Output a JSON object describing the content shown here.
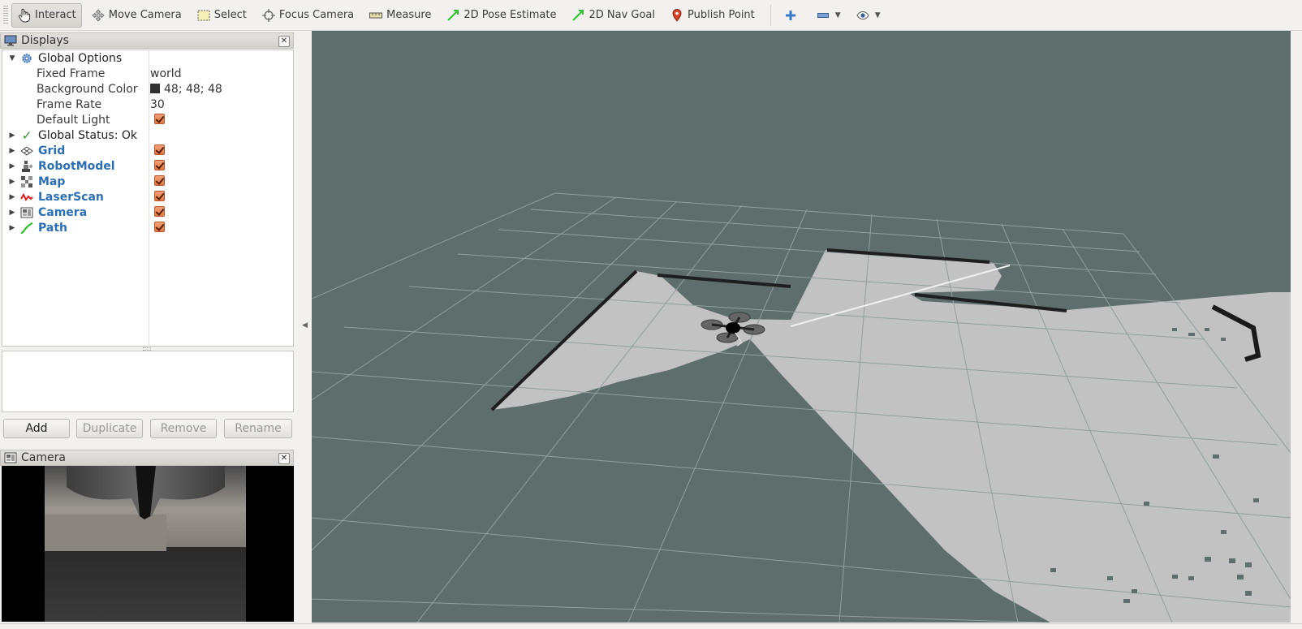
{
  "toolbar": {
    "tools": [
      {
        "label": "Interact",
        "icon": "hand-pointer-icon",
        "active": true
      },
      {
        "label": "Move Camera",
        "icon": "move-arrows-icon"
      },
      {
        "label": "Select",
        "icon": "selection-box-icon"
      },
      {
        "label": "Focus Camera",
        "icon": "crosshair-icon"
      },
      {
        "label": "Measure",
        "icon": "ruler-icon"
      },
      {
        "label": "2D Pose Estimate",
        "icon": "green-arrow-icon"
      },
      {
        "label": "2D Nav Goal",
        "icon": "green-arrow-icon"
      },
      {
        "label": "Publish Point",
        "icon": "map-pin-icon"
      }
    ],
    "extra_icons": [
      "add-plus-icon",
      "remove-minus-icon",
      "eye-icon"
    ]
  },
  "displays_panel": {
    "title": "Displays",
    "global_options": {
      "label": "Global Options",
      "fixed_frame": {
        "label": "Fixed Frame",
        "value": "world"
      },
      "background_color": {
        "label": "Background Color",
        "value": "48; 48; 48",
        "swatch": "#303030"
      },
      "frame_rate": {
        "label": "Frame Rate",
        "value": "30"
      },
      "default_light": {
        "label": "Default Light",
        "checked": true
      }
    },
    "global_status": {
      "label": "Global Status: Ok"
    },
    "displays": [
      {
        "name": "Grid",
        "icon": "grid-icon",
        "enabled": true
      },
      {
        "name": "RobotModel",
        "icon": "robot-icon",
        "enabled": true
      },
      {
        "name": "Map",
        "icon": "map-icon",
        "enabled": true
      },
      {
        "name": "LaserScan",
        "icon": "laser-scan-icon",
        "enabled": true
      },
      {
        "name": "Camera",
        "icon": "camera-icon",
        "enabled": true
      },
      {
        "name": "Path",
        "icon": "path-icon",
        "enabled": true
      }
    ],
    "buttons": {
      "add": "Add",
      "duplicate": "Duplicate",
      "remove": "Remove",
      "rename": "Rename"
    }
  },
  "camera_panel": {
    "title": "Camera"
  },
  "colors": {
    "viewport_bg": "#5d6e6c",
    "map_free": "#c2c2c2",
    "map_wall": "#1e1e1e",
    "grid_line": "#8fa09e",
    "link_blue": "#2a6fb5",
    "checkbox_orange": "#e07a47"
  }
}
